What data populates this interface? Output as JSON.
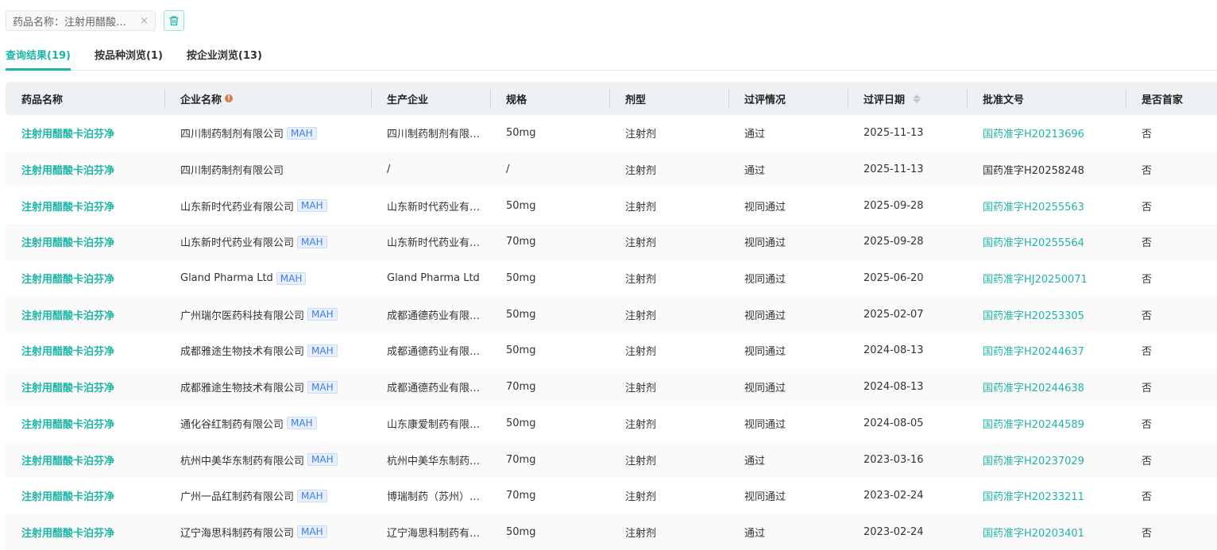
{
  "filter": {
    "text": "药品名称：注射用醋酸卡泊芬净",
    "close": "×"
  },
  "tabs": [
    {
      "label": "查询结果(19)"
    },
    {
      "label": "按品种浏览(1)"
    },
    {
      "label": "按企业浏览(13)"
    }
  ],
  "columns": [
    "药品名称",
    "企业名称",
    "生产企业",
    "规格",
    "剂型",
    "过评情况",
    "过评日期",
    "批准文号",
    "是否首家"
  ],
  "mah_label": "MAH",
  "rows": [
    {
      "drug": "注射用醋酸卡泊芬净",
      "company": "四川制药制剂有限公司",
      "mah": true,
      "maker": "四川制药制剂有限公司",
      "spec": "50mg",
      "form": "注射剂",
      "status": "通过",
      "date": "2025-11-13",
      "approval": "国药准字H20213696",
      "link": true,
      "first": "否"
    },
    {
      "drug": "注射用醋酸卡泊芬净",
      "company": "四川制药制剂有限公司",
      "mah": false,
      "maker": "/",
      "spec": "/",
      "form": "注射剂",
      "status": "通过",
      "date": "2025-11-13",
      "approval": "国药准字H20258248",
      "link": false,
      "first": "否"
    },
    {
      "drug": "注射用醋酸卡泊芬净",
      "company": "山东新时代药业有限公司",
      "mah": true,
      "maker": "山东新时代药业有限公司",
      "spec": "50mg",
      "form": "注射剂",
      "status": "视同通过",
      "date": "2025-09-28",
      "approval": "国药准字H20255563",
      "link": true,
      "first": "否"
    },
    {
      "drug": "注射用醋酸卡泊芬净",
      "company": "山东新时代药业有限公司",
      "mah": true,
      "maker": "山东新时代药业有限公司",
      "spec": "70mg",
      "form": "注射剂",
      "status": "视同通过",
      "date": "2025-09-28",
      "approval": "国药准字H20255564",
      "link": true,
      "first": "否"
    },
    {
      "drug": "注射用醋酸卡泊芬净",
      "company": "Gland Pharma Ltd",
      "mah": true,
      "maker": "Gland Pharma Ltd",
      "spec": "50mg",
      "form": "注射剂",
      "status": "视同通过",
      "date": "2025-06-20",
      "approval": "国药准字HJ20250071",
      "link": true,
      "first": "否"
    },
    {
      "drug": "注射用醋酸卡泊芬净",
      "company": "广州瑞尔医药科技有限公司",
      "mah": true,
      "maker": "成都通德药业有限公司",
      "spec": "50mg",
      "form": "注射剂",
      "status": "视同通过",
      "date": "2025-02-07",
      "approval": "国药准字H20253305",
      "link": true,
      "first": "否"
    },
    {
      "drug": "注射用醋酸卡泊芬净",
      "company": "成都雅途生物技术有限公司",
      "mah": true,
      "maker": "成都通德药业有限公司",
      "spec": "50mg",
      "form": "注射剂",
      "status": "视同通过",
      "date": "2024-08-13",
      "approval": "国药准字H20244637",
      "link": true,
      "first": "否"
    },
    {
      "drug": "注射用醋酸卡泊芬净",
      "company": "成都雅途生物技术有限公司",
      "mah": true,
      "maker": "成都通德药业有限公司",
      "spec": "70mg",
      "form": "注射剂",
      "status": "视同通过",
      "date": "2024-08-13",
      "approval": "国药准字H20244638",
      "link": true,
      "first": "否"
    },
    {
      "drug": "注射用醋酸卡泊芬净",
      "company": "通化谷红制药有限公司",
      "mah": true,
      "maker": "山东康爱制药有限公司",
      "spec": "50mg",
      "form": "注射剂",
      "status": "视同通过",
      "date": "2024-08-05",
      "approval": "国药准字H20244589",
      "link": true,
      "first": "否"
    },
    {
      "drug": "注射用醋酸卡泊芬净",
      "company": "杭州中美华东制药有限公司",
      "mah": true,
      "maker": "杭州中美华东制药有限公司",
      "spec": "70mg",
      "form": "注射剂",
      "status": "通过",
      "date": "2023-03-16",
      "approval": "国药准字H20237029",
      "link": true,
      "first": "否"
    },
    {
      "drug": "注射用醋酸卡泊芬净",
      "company": "广州一品红制药有限公司",
      "mah": true,
      "maker": "博瑞制药（苏州）有限公司",
      "spec": "70mg",
      "form": "注射剂",
      "status": "视同通过",
      "date": "2023-02-24",
      "approval": "国药准字H20233211",
      "link": true,
      "first": "否"
    },
    {
      "drug": "注射用醋酸卡泊芬净",
      "company": "辽宁海思科制药有限公司",
      "mah": true,
      "maker": "辽宁海思科制药有限公司",
      "spec": "50mg",
      "form": "注射剂",
      "status": "通过",
      "date": "2023-02-24",
      "approval": "国药准字H20203401",
      "link": true,
      "first": "否"
    }
  ]
}
